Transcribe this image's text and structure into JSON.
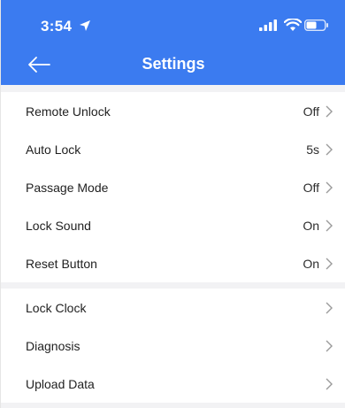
{
  "status_bar": {
    "time": "3:54"
  },
  "header": {
    "title": "Settings"
  },
  "group1": [
    {
      "label": "Remote Unlock",
      "value": "Off"
    },
    {
      "label": "Auto Lock",
      "value": "5s"
    },
    {
      "label": "Passage Mode",
      "value": "Off"
    },
    {
      "label": "Lock Sound",
      "value": "On"
    },
    {
      "label": "Reset Button",
      "value": "On"
    }
  ],
  "group2": [
    {
      "label": "Lock Clock"
    },
    {
      "label": "Diagnosis"
    },
    {
      "label": "Upload Data"
    }
  ],
  "colors": {
    "accent": "#3b7bf0",
    "background": "#f2f2f4"
  }
}
